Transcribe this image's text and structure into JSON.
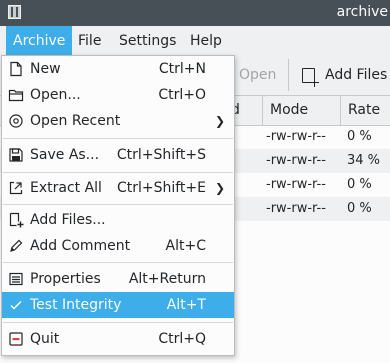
{
  "window": {
    "title": "archive"
  },
  "menubar": {
    "items": [
      "Archive",
      "File",
      "Settings",
      "Help"
    ]
  },
  "toolbar": {
    "open_label": "Open",
    "add_files_label": "Add Files"
  },
  "table": {
    "headers": [
      "d",
      "Mode",
      "Rate"
    ],
    "rows": [
      {
        "mode": "-rw-rw-r--",
        "rate": "0 %"
      },
      {
        "mode": "-rw-rw-r--",
        "rate": "34 %"
      },
      {
        "mode": "-rw-rw-r--",
        "rate": "0 %"
      },
      {
        "mode": "-rw-rw-r--",
        "rate": "0 %"
      }
    ]
  },
  "archive_menu": {
    "items": [
      {
        "label": "New",
        "shortcut": "Ctrl+N",
        "icon": "new-document-icon"
      },
      {
        "label": "Open...",
        "shortcut": "Ctrl+O",
        "icon": "folder-open-icon"
      },
      {
        "label": "Open Recent",
        "shortcut": "",
        "icon": "open-recent-icon",
        "submenu": true
      },
      {
        "label": "Save As...",
        "shortcut": "Ctrl+Shift+S",
        "icon": "save-as-icon"
      },
      {
        "label": "Extract All",
        "shortcut": "Ctrl+Shift+E",
        "icon": "extract-icon",
        "submenu": true
      },
      {
        "label": "Add Files...",
        "shortcut": "",
        "icon": "add-files-icon"
      },
      {
        "label": "Add Comment",
        "shortcut": "Alt+C",
        "icon": "pencil-icon"
      },
      {
        "label": "Properties",
        "shortcut": "Alt+Return",
        "icon": "properties-icon"
      },
      {
        "label": "Test Integrity",
        "shortcut": "Alt+T",
        "icon": "checkmark-icon",
        "highlighted": true
      },
      {
        "label": "Quit",
        "shortcut": "Ctrl+Q",
        "icon": "quit-icon"
      }
    ]
  },
  "colors": {
    "accent": "#3daee9",
    "titlebar": "#475057",
    "quit_icon": "#da4453"
  }
}
